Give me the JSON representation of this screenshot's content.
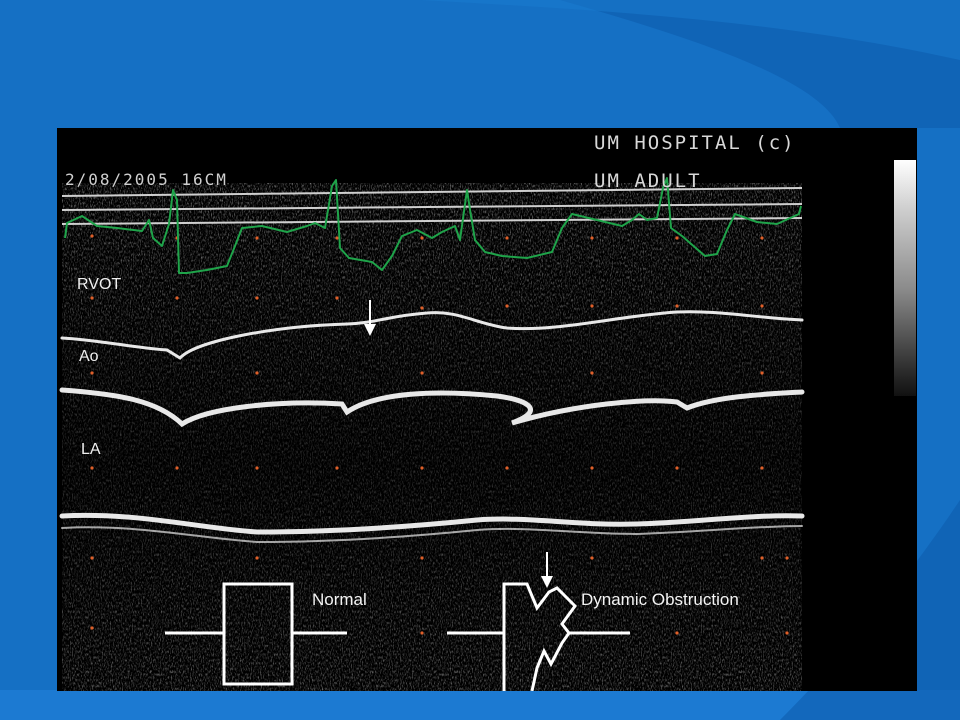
{
  "header": {
    "hospital": "UM HOSPITAL (c)",
    "left_text": "2/08/2005  16CM",
    "mode": "UM ADULT"
  },
  "labels": {
    "rvot": "RVOT",
    "ao": "Ao",
    "la": "LA"
  },
  "diagrams": {
    "normal": "Normal",
    "obstruction": "Dynamic Obstruction"
  },
  "colors": {
    "slide_background": "#1570c4",
    "ecg_trace": "#1fa44a",
    "image_background": "#000000",
    "markers": "#e0602a"
  }
}
